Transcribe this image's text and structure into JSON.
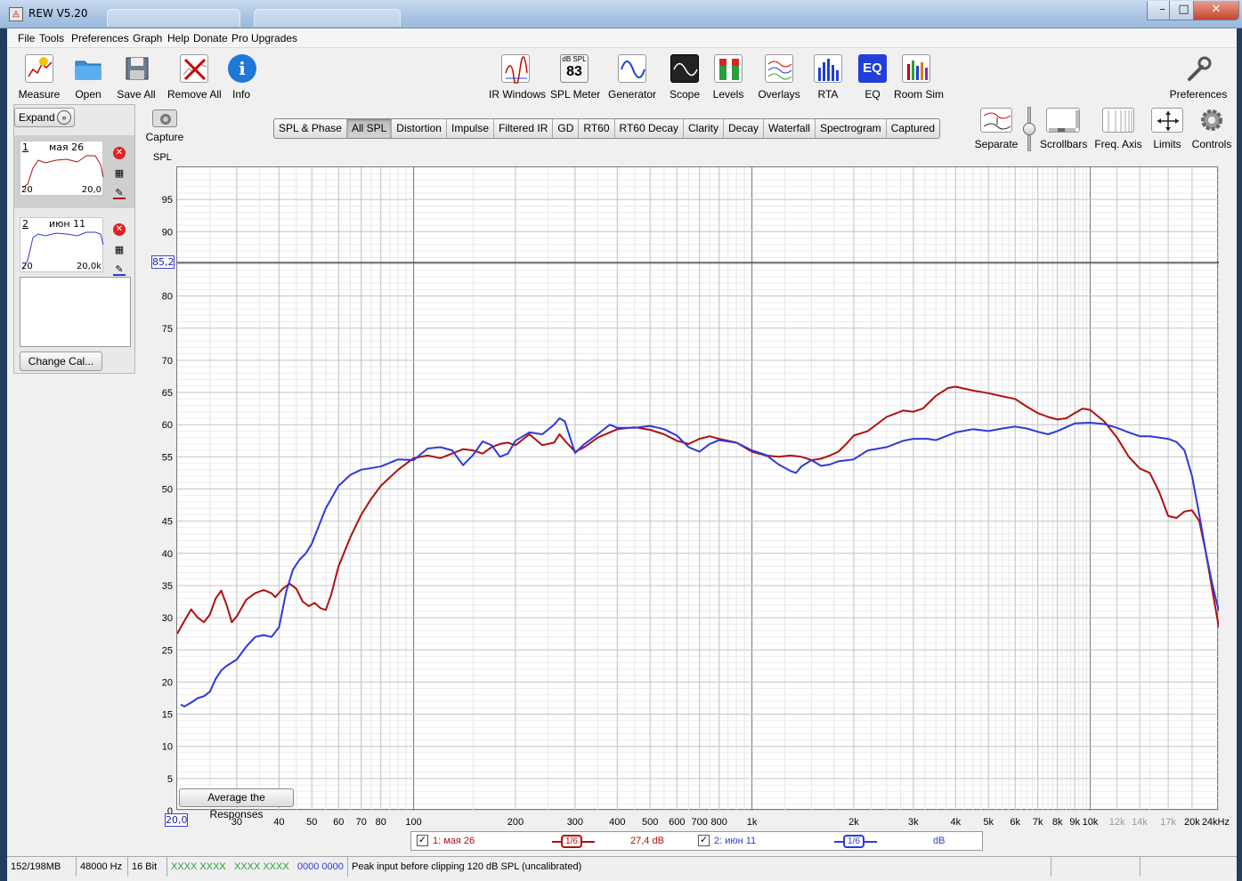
{
  "window": {
    "title": "REW V5.20"
  },
  "menu": [
    "File",
    "Tools",
    "Preferences",
    "Graph",
    "Help",
    "Donate",
    "Pro Upgrades"
  ],
  "toolbar_left": [
    {
      "label": "Measure",
      "icon": "measure-icon"
    },
    {
      "label": "Open",
      "icon": "folder-icon"
    },
    {
      "label": "Save All",
      "icon": "save-icon"
    },
    {
      "label": "Remove All",
      "icon": "remove-icon"
    },
    {
      "label": "Info",
      "icon": "info-icon"
    }
  ],
  "toolbar_center": [
    {
      "label": "IR Windows",
      "icon": "ir-windows-icon"
    },
    {
      "label": "SPL Meter",
      "icon": "spl-meter-icon",
      "meter_unit": "dB SPL",
      "meter_value": "83"
    },
    {
      "label": "Generator",
      "icon": "generator-icon"
    },
    {
      "label": "Scope",
      "icon": "scope-icon"
    },
    {
      "label": "Levels",
      "icon": "levels-icon"
    },
    {
      "label": "Overlays",
      "icon": "overlays-icon"
    },
    {
      "label": "RTA",
      "icon": "rta-icon"
    },
    {
      "label": "EQ",
      "icon": "eq-icon"
    },
    {
      "label": "Room Sim",
      "icon": "room-sim-icon"
    }
  ],
  "toolbar_right": {
    "label": "Preferences",
    "icon": "wrench-icon"
  },
  "graph_controls": [
    {
      "label": "Separate",
      "icon": "separate-icon"
    },
    {
      "label": "Scrollbars",
      "icon": "scrollbars-icon"
    },
    {
      "label": "Freq. Axis",
      "icon": "freq-axis-icon"
    },
    {
      "label": "Limits",
      "icon": "limits-icon"
    },
    {
      "label": "Controls",
      "icon": "controls-gear-icon"
    }
  ],
  "capture": {
    "label": "Capture",
    "icon": "camera-icon"
  },
  "left_panel": {
    "expand_label": "Expand",
    "change_cal_label": "Change Cal...",
    "measurements": [
      {
        "num": "1",
        "name": "мая 26",
        "x_start": "20",
        "x_end": "20,0",
        "color": "#b01010"
      },
      {
        "num": "2",
        "name": "июн 11",
        "x_start": "20",
        "x_end": "20,0k",
        "color": "#2e3ad8"
      }
    ]
  },
  "tabs": [
    {
      "label": "SPL & Phase",
      "active": false
    },
    {
      "label": "All SPL",
      "active": true
    },
    {
      "label": "Distortion",
      "active": false
    },
    {
      "label": "Impulse",
      "active": false
    },
    {
      "label": "Filtered IR",
      "active": false
    },
    {
      "label": "GD",
      "active": false
    },
    {
      "label": "RT60",
      "active": false
    },
    {
      "label": "RT60 Decay",
      "active": false
    },
    {
      "label": "Clarity",
      "active": false
    },
    {
      "label": "Decay",
      "active": false
    },
    {
      "label": "Waterfall",
      "active": false
    },
    {
      "label": "Spectrogram",
      "active": false
    },
    {
      "label": "Captured",
      "active": false
    }
  ],
  "graph": {
    "y_title": "SPL",
    "cursor_y": "85,2",
    "cursor_x": "20,0",
    "average_button": "Average the Responses"
  },
  "chart_data": {
    "type": "line",
    "title": "",
    "xlabel": "",
    "ylabel": "SPL",
    "x_scale": "log",
    "xlim": [
      20,
      24000
    ],
    "ylim": [
      0,
      100
    ],
    "grid": true,
    "y_ticks": [
      "0",
      "5",
      "10",
      "15",
      "20",
      "25",
      "30",
      "35",
      "40",
      "45",
      "50",
      "55",
      "60",
      "65",
      "70",
      "75",
      "80",
      "85",
      "90",
      "95"
    ],
    "x_ticks": [
      {
        "v": 30,
        "t": "30",
        "dim": false
      },
      {
        "v": 40,
        "t": "40",
        "dim": false
      },
      {
        "v": 50,
        "t": "50",
        "dim": false
      },
      {
        "v": 60,
        "t": "60",
        "dim": false
      },
      {
        "v": 70,
        "t": "70",
        "dim": false
      },
      {
        "v": 80,
        "t": "80",
        "dim": false
      },
      {
        "v": 100,
        "t": "100",
        "dim": false
      },
      {
        "v": 200,
        "t": "200",
        "dim": false
      },
      {
        "v": 300,
        "t": "300",
        "dim": false
      },
      {
        "v": 400,
        "t": "400",
        "dim": false
      },
      {
        "v": 500,
        "t": "500",
        "dim": false
      },
      {
        "v": 600,
        "t": "600",
        "dim": false
      },
      {
        "v": 700,
        "t": "700",
        "dim": false
      },
      {
        "v": 800,
        "t": "800",
        "dim": false
      },
      {
        "v": 1000,
        "t": "1k",
        "dim": false
      },
      {
        "v": 2000,
        "t": "2k",
        "dim": false
      },
      {
        "v": 3000,
        "t": "3k",
        "dim": false
      },
      {
        "v": 4000,
        "t": "4k",
        "dim": false
      },
      {
        "v": 5000,
        "t": "5k",
        "dim": false
      },
      {
        "v": 6000,
        "t": "6k",
        "dim": false
      },
      {
        "v": 7000,
        "t": "7k",
        "dim": false
      },
      {
        "v": 8000,
        "t": "8k",
        "dim": false
      },
      {
        "v": 9000,
        "t": "9k",
        "dim": false
      },
      {
        "v": 10000,
        "t": "10k",
        "dim": false
      },
      {
        "v": 12000,
        "t": "12k",
        "dim": true
      },
      {
        "v": 14000,
        "t": "14k",
        "dim": true
      },
      {
        "v": 17000,
        "t": "17k",
        "dim": true
      },
      {
        "v": 20000,
        "t": "20k",
        "dim": false
      },
      {
        "v": 24000,
        "t": "24kHz",
        "dim": false
      }
    ],
    "horizontal_cursor_db": 85.2,
    "series": [
      {
        "name": "1: мая 26",
        "color": "#b01010",
        "points": [
          [
            20,
            27.5
          ],
          [
            21,
            29.5
          ],
          [
            22,
            31.3
          ],
          [
            23,
            30
          ],
          [
            24,
            29.3
          ],
          [
            25,
            30.5
          ],
          [
            26,
            33
          ],
          [
            27,
            34.2
          ],
          [
            28,
            32
          ],
          [
            29,
            29.3
          ],
          [
            30,
            30.2
          ],
          [
            32,
            32.8
          ],
          [
            34,
            33.8
          ],
          [
            36,
            34.3
          ],
          [
            38,
            33.8
          ],
          [
            39,
            33.2
          ],
          [
            41,
            34.5
          ],
          [
            43,
            35.3
          ],
          [
            45,
            34.5
          ],
          [
            47,
            32.5
          ],
          [
            49,
            31.8
          ],
          [
            51,
            32.3
          ],
          [
            53,
            31.5
          ],
          [
            55,
            31.2
          ],
          [
            57,
            33.5
          ],
          [
            60,
            38
          ],
          [
            65,
            42.5
          ],
          [
            70,
            46
          ],
          [
            75,
            48.5
          ],
          [
            80,
            50.5
          ],
          [
            90,
            53
          ],
          [
            100,
            54.8
          ],
          [
            110,
            55.2
          ],
          [
            120,
            54.8
          ],
          [
            130,
            55.5
          ],
          [
            140,
            56.2
          ],
          [
            150,
            56
          ],
          [
            160,
            55.5
          ],
          [
            170,
            56.5
          ],
          [
            180,
            57
          ],
          [
            190,
            57.2
          ],
          [
            200,
            56.8
          ],
          [
            220,
            58.5
          ],
          [
            240,
            56.8
          ],
          [
            260,
            57.2
          ],
          [
            270,
            58.5
          ],
          [
            280,
            57.5
          ],
          [
            300,
            55.8
          ],
          [
            320,
            56.5
          ],
          [
            350,
            58
          ],
          [
            380,
            58.8
          ],
          [
            400,
            59.3
          ],
          [
            450,
            59.6
          ],
          [
            500,
            59.2
          ],
          [
            550,
            58.5
          ],
          [
            600,
            57.5
          ],
          [
            650,
            57
          ],
          [
            700,
            57.8
          ],
          [
            750,
            58.2
          ],
          [
            800,
            57.8
          ],
          [
            900,
            57.2
          ],
          [
            1000,
            55.8
          ],
          [
            1100,
            55.2
          ],
          [
            1200,
            55
          ],
          [
            1300,
            55.2
          ],
          [
            1400,
            55
          ],
          [
            1500,
            54.5
          ],
          [
            1600,
            54.7
          ],
          [
            1700,
            55.2
          ],
          [
            1800,
            55.8
          ],
          [
            1900,
            57
          ],
          [
            2000,
            58.3
          ],
          [
            2200,
            59
          ],
          [
            2500,
            61.2
          ],
          [
            2800,
            62.2
          ],
          [
            3000,
            62
          ],
          [
            3200,
            62.5
          ],
          [
            3500,
            64.5
          ],
          [
            3800,
            65.7
          ],
          [
            4000,
            65.9
          ],
          [
            4500,
            65.3
          ],
          [
            5000,
            64.9
          ],
          [
            5500,
            64.4
          ],
          [
            6000,
            64
          ],
          [
            6500,
            62.8
          ],
          [
            7000,
            61.8
          ],
          [
            7500,
            61.2
          ],
          [
            8000,
            60.8
          ],
          [
            8500,
            61
          ],
          [
            9000,
            61.8
          ],
          [
            9500,
            62.5
          ],
          [
            10000,
            62.3
          ],
          [
            11000,
            60.5
          ],
          [
            12000,
            58
          ],
          [
            13000,
            55
          ],
          [
            14000,
            53.2
          ],
          [
            15000,
            52.5
          ],
          [
            16000,
            49.5
          ],
          [
            17000,
            45.8
          ],
          [
            18000,
            45.5
          ],
          [
            19000,
            46.5
          ],
          [
            20000,
            46.7
          ],
          [
            21000,
            45
          ],
          [
            22000,
            40
          ],
          [
            23000,
            34
          ],
          [
            24000,
            28.5
          ]
        ]
      },
      {
        "name": "2: июн 11",
        "color": "#2e3ad8",
        "points": [
          [
            20.5,
            16.5
          ],
          [
            21,
            16.2
          ],
          [
            22,
            16.8
          ],
          [
            23,
            17.5
          ],
          [
            24,
            17.8
          ],
          [
            25,
            18.5
          ],
          [
            26,
            20.5
          ],
          [
            27,
            21.8
          ],
          [
            28,
            22.5
          ],
          [
            30,
            23.5
          ],
          [
            32,
            25.5
          ],
          [
            34,
            27
          ],
          [
            36,
            27.3
          ],
          [
            38,
            27
          ],
          [
            40,
            28.5
          ],
          [
            42,
            34
          ],
          [
            44,
            37.5
          ],
          [
            46,
            39
          ],
          [
            48,
            40
          ],
          [
            50,
            41.5
          ],
          [
            55,
            47
          ],
          [
            60,
            50.5
          ],
          [
            65,
            52.2
          ],
          [
            70,
            53
          ],
          [
            80,
            53.5
          ],
          [
            90,
            54.6
          ],
          [
            100,
            54.5
          ],
          [
            110,
            56.3
          ],
          [
            120,
            56.5
          ],
          [
            130,
            56
          ],
          [
            140,
            53.7
          ],
          [
            150,
            55.3
          ],
          [
            160,
            57.4
          ],
          [
            170,
            56.8
          ],
          [
            180,
            55
          ],
          [
            190,
            55.5
          ],
          [
            200,
            57.5
          ],
          [
            220,
            58.8
          ],
          [
            240,
            58.5
          ],
          [
            260,
            60
          ],
          [
            270,
            61
          ],
          [
            280,
            60.5
          ],
          [
            300,
            55.6
          ],
          [
            320,
            57
          ],
          [
            350,
            58.5
          ],
          [
            380,
            60
          ],
          [
            400,
            59.5
          ],
          [
            450,
            59.5
          ],
          [
            500,
            59.8
          ],
          [
            550,
            59.3
          ],
          [
            600,
            58.3
          ],
          [
            650,
            56.5
          ],
          [
            700,
            55.8
          ],
          [
            750,
            57
          ],
          [
            800,
            57.6
          ],
          [
            900,
            57.2
          ],
          [
            1000,
            56
          ],
          [
            1100,
            55.3
          ],
          [
            1200,
            53.8
          ],
          [
            1300,
            52.8
          ],
          [
            1350,
            52.5
          ],
          [
            1400,
            53.5
          ],
          [
            1500,
            54.5
          ],
          [
            1600,
            53.6
          ],
          [
            1700,
            53.8
          ],
          [
            1800,
            54.3
          ],
          [
            2000,
            54.6
          ],
          [
            2200,
            56
          ],
          [
            2500,
            56.5
          ],
          [
            2800,
            57.5
          ],
          [
            3000,
            57.8
          ],
          [
            3300,
            57.8
          ],
          [
            3500,
            57.6
          ],
          [
            4000,
            58.8
          ],
          [
            4500,
            59.3
          ],
          [
            5000,
            59
          ],
          [
            5500,
            59.4
          ],
          [
            6000,
            59.7
          ],
          [
            6500,
            59.4
          ],
          [
            7000,
            58.9
          ],
          [
            7500,
            58.5
          ],
          [
            8000,
            59
          ],
          [
            9000,
            60.2
          ],
          [
            10000,
            60.3
          ],
          [
            11000,
            60.1
          ],
          [
            12000,
            59.5
          ],
          [
            13000,
            58.8
          ],
          [
            14000,
            58.2
          ],
          [
            15000,
            58.2
          ],
          [
            16000,
            58
          ],
          [
            17000,
            57.8
          ],
          [
            18000,
            57.3
          ],
          [
            19000,
            56
          ],
          [
            20000,
            52
          ],
          [
            21000,
            46
          ],
          [
            22000,
            40
          ],
          [
            23000,
            35
          ],
          [
            24000,
            31
          ]
        ]
      }
    ]
  },
  "legend": [
    {
      "label": "1: мая 26",
      "smoothing": "1/6",
      "value": "27,4 dB",
      "color": "#b01010"
    },
    {
      "label": "2: июн 11",
      "smoothing": "1/6",
      "value": "dB",
      "color": "#2e3ad8"
    }
  ],
  "status": {
    "memory": "152/198MB",
    "rate": "48000 Hz",
    "bits": "16 Bit",
    "input_a": "XXXX XXXX",
    "input_b": "XXXX XXXX",
    "input_c": "0000 0000",
    "message": "Peak input before clipping 120 dB SPL (uncalibrated)"
  }
}
